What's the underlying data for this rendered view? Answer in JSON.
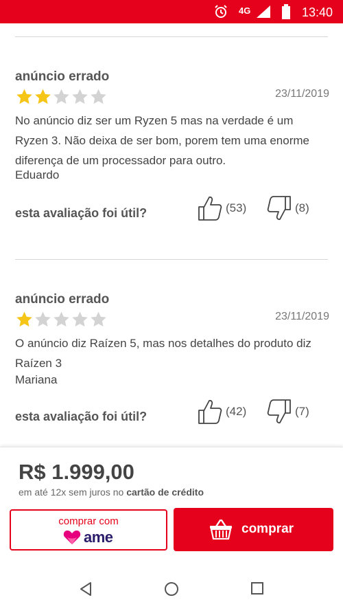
{
  "status_bar": {
    "network": "4G",
    "time": "13:40"
  },
  "reviews": [
    {
      "title": "anúncio errado",
      "rating": 2,
      "max_rating": 5,
      "date": "23/11/2019",
      "body": "No anúncio diz ser um Ryzen 5 mas na verdade é um Ryzen 3. Não deixa de ser bom, porem tem uma enorme diferença de um processador para outro.",
      "author": "Eduardo",
      "helpful_label": "esta avaliação foi útil?",
      "likes": "(53)",
      "dislikes": "(8)"
    },
    {
      "title": "anúncio errado",
      "rating": 1,
      "max_rating": 5,
      "date": "23/11/2019",
      "body": "O anúncio diz Raízen 5, mas nos detalhes do produto diz Raízen 3",
      "author": "Mariana",
      "helpful_label": "esta avaliação foi útil?",
      "likes": "(42)",
      "dislikes": "(7)"
    }
  ],
  "purchase": {
    "price": "R$ 1.999,00",
    "installments_prefix": "em até 12x sem juros no",
    "installments_bold": "cartão de crédito",
    "ame_button_top": "comprar com",
    "ame_button_brand": "ame",
    "buy_button": "comprar"
  },
  "colors": {
    "brand_red": "#e5001b",
    "star_gold": "#f5c518",
    "star_gray": "#d3d3d3",
    "ame_purple": "#2b1d6b",
    "ame_pink": "#e6007e"
  },
  "icons": {
    "status": [
      "alarm-icon",
      "signal-icon",
      "battery-icon"
    ],
    "review": [
      "star-icon",
      "thumbs-up-icon",
      "thumbs-down-icon"
    ],
    "buttons": [
      "ame-heart-icon",
      "basket-icon"
    ],
    "nav": [
      "back-icon",
      "home-icon",
      "recents-icon"
    ]
  }
}
